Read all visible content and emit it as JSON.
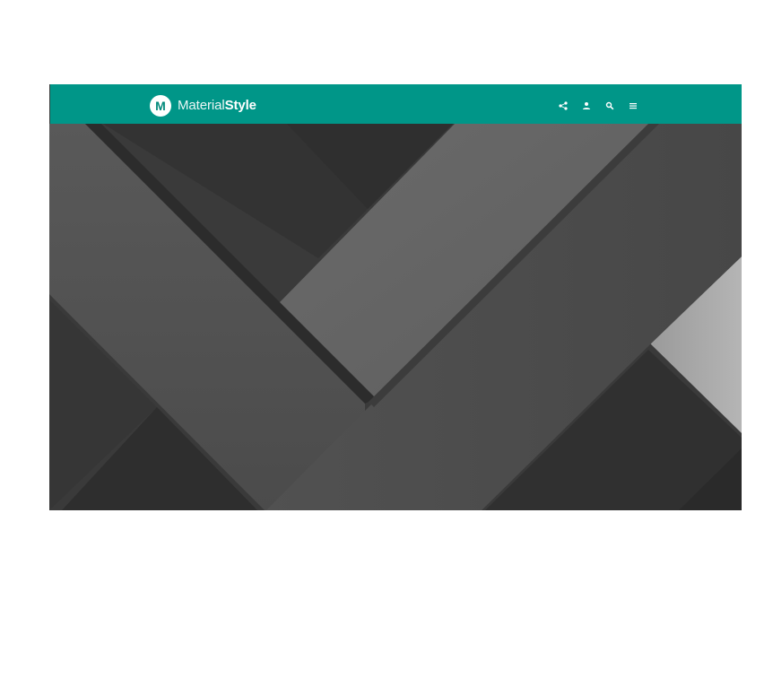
{
  "brand": {
    "logo_letter": "M",
    "name_light": "Material",
    "name_bold": "Style"
  },
  "toolbar": {
    "actions": [
      {
        "icon": "share-icon"
      },
      {
        "icon": "person-icon"
      },
      {
        "icon": "search-icon"
      },
      {
        "icon": "menu-icon"
      }
    ]
  },
  "colors": {
    "appbar": "#009688",
    "background": "#ffffff",
    "hero_dark": "#333333",
    "hero_mid": "#4a4a4a",
    "hero_light": "#656565"
  }
}
